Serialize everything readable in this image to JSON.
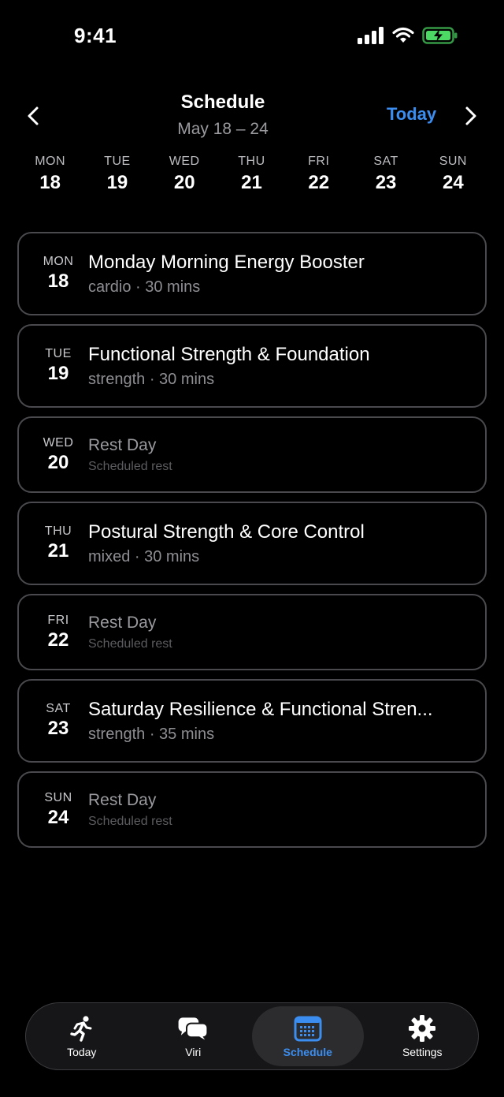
{
  "status": {
    "time": "9:41"
  },
  "header": {
    "title": "Schedule",
    "range": "May 18 – 24",
    "today_label": "Today"
  },
  "week": [
    {
      "dow": "MON",
      "num": "18"
    },
    {
      "dow": "TUE",
      "num": "19"
    },
    {
      "dow": "WED",
      "num": "20"
    },
    {
      "dow": "THU",
      "num": "21"
    },
    {
      "dow": "FRI",
      "num": "22"
    },
    {
      "dow": "SAT",
      "num": "23"
    },
    {
      "dow": "SUN",
      "num": "24"
    }
  ],
  "schedule": [
    {
      "dow": "MON",
      "num": "18",
      "title": "Monday Morning Energy Booster",
      "meta": "cardio · 30 mins"
    },
    {
      "dow": "TUE",
      "num": "19",
      "title": "Functional Strength & Foundation",
      "meta": "strength · 30 mins"
    },
    {
      "dow": "WED",
      "num": "20",
      "title": "Rest Day",
      "meta": "Scheduled rest"
    },
    {
      "dow": "THU",
      "num": "21",
      "title": "Postural Strength & Core Control",
      "meta": "mixed · 30 mins"
    },
    {
      "dow": "FRI",
      "num": "22",
      "title": "Rest Day",
      "meta": "Scheduled rest"
    },
    {
      "dow": "SAT",
      "num": "23",
      "title": "Saturday Resilience & Functional Stren...",
      "meta": "strength · 35 mins"
    },
    {
      "dow": "SUN",
      "num": "24",
      "title": "Rest Day",
      "meta": "Scheduled rest"
    }
  ],
  "tabs": [
    {
      "label": "Today",
      "icon": "runner-icon"
    },
    {
      "label": "Viri",
      "icon": "chat-bubbles-icon"
    },
    {
      "label": "Schedule",
      "icon": "calendar-icon",
      "active": true
    },
    {
      "label": "Settings",
      "icon": "gear-icon"
    }
  ],
  "colors": {
    "accent": "#3b8ef0",
    "battery": "#4cd964",
    "background": "#000000"
  }
}
